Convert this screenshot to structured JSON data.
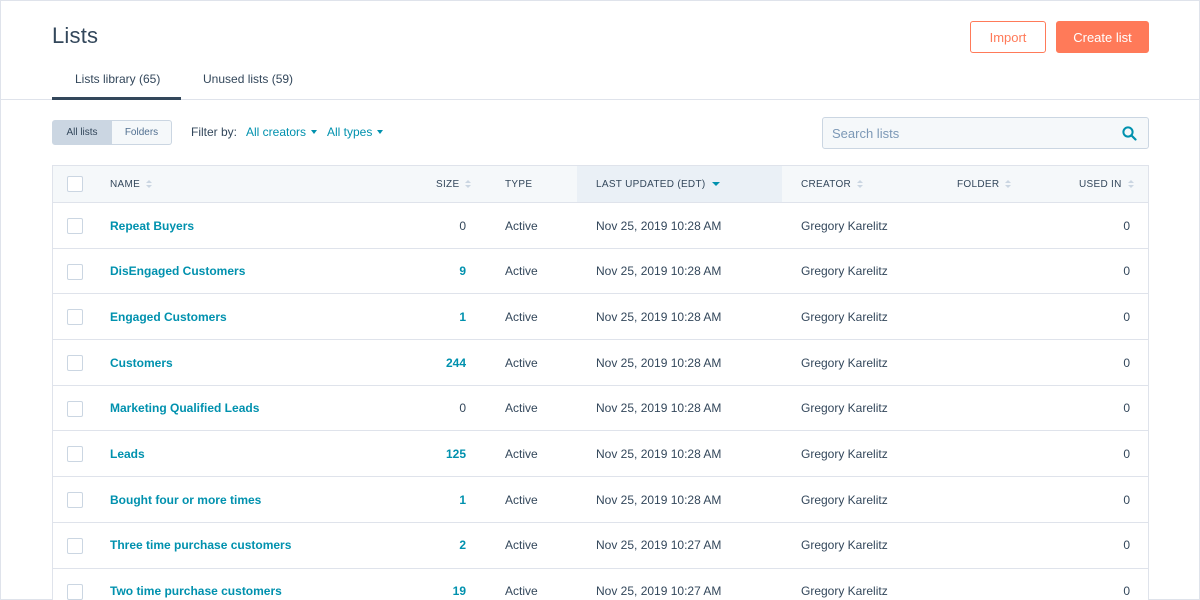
{
  "page": {
    "title": "Lists"
  },
  "header_buttons": {
    "import_label": "Import",
    "create_label": "Create list"
  },
  "tabs": [
    {
      "label": "Lists library (65)",
      "active": true
    },
    {
      "label": "Unused lists (59)",
      "active": false
    }
  ],
  "toolbar": {
    "toggle_all": "All lists",
    "toggle_folders": "Folders",
    "filter_label": "Filter by:",
    "creators_dropdown": "All creators",
    "types_dropdown": "All types",
    "search_placeholder": "Search lists",
    "search_icon": "search-icon"
  },
  "table": {
    "columns": {
      "name": "NAME",
      "size": "SIZE",
      "type": "TYPE",
      "last_updated": "LAST UPDATED (EDT)",
      "creator": "CREATOR",
      "folder": "FOLDER",
      "used_in": "USED IN"
    },
    "rows": [
      {
        "name": "Repeat Buyers",
        "size": "0",
        "type": "Active",
        "updated": "Nov 25, 2019 10:28 AM",
        "creator": "Gregory Karelitz",
        "folder": "",
        "used_in": "0"
      },
      {
        "name": "DisEngaged Customers",
        "size": "9",
        "type": "Active",
        "updated": "Nov 25, 2019 10:28 AM",
        "creator": "Gregory Karelitz",
        "folder": "",
        "used_in": "0"
      },
      {
        "name": "Engaged Customers",
        "size": "1",
        "type": "Active",
        "updated": "Nov 25, 2019 10:28 AM",
        "creator": "Gregory Karelitz",
        "folder": "",
        "used_in": "0"
      },
      {
        "name": "Customers",
        "size": "244",
        "type": "Active",
        "updated": "Nov 25, 2019 10:28 AM",
        "creator": "Gregory Karelitz",
        "folder": "",
        "used_in": "0"
      },
      {
        "name": "Marketing Qualified Leads",
        "size": "0",
        "type": "Active",
        "updated": "Nov 25, 2019 10:28 AM",
        "creator": "Gregory Karelitz",
        "folder": "",
        "used_in": "0"
      },
      {
        "name": "Leads",
        "size": "125",
        "type": "Active",
        "updated": "Nov 25, 2019 10:28 AM",
        "creator": "Gregory Karelitz",
        "folder": "",
        "used_in": "0"
      },
      {
        "name": "Bought four or more times",
        "size": "1",
        "type": "Active",
        "updated": "Nov 25, 2019 10:28 AM",
        "creator": "Gregory Karelitz",
        "folder": "",
        "used_in": "0"
      },
      {
        "name": "Three time purchase customers",
        "size": "2",
        "type": "Active",
        "updated": "Nov 25, 2019 10:27 AM",
        "creator": "Gregory Karelitz",
        "folder": "",
        "used_in": "0"
      },
      {
        "name": "Two time purchase customers",
        "size": "19",
        "type": "Active",
        "updated": "Nov 25, 2019 10:27 AM",
        "creator": "Gregory Karelitz",
        "folder": "",
        "used_in": "0"
      }
    ]
  },
  "colors": {
    "accent": "#ff7a59",
    "link": "#0091ae",
    "text": "#33475b",
    "border": "#dfe3eb"
  }
}
